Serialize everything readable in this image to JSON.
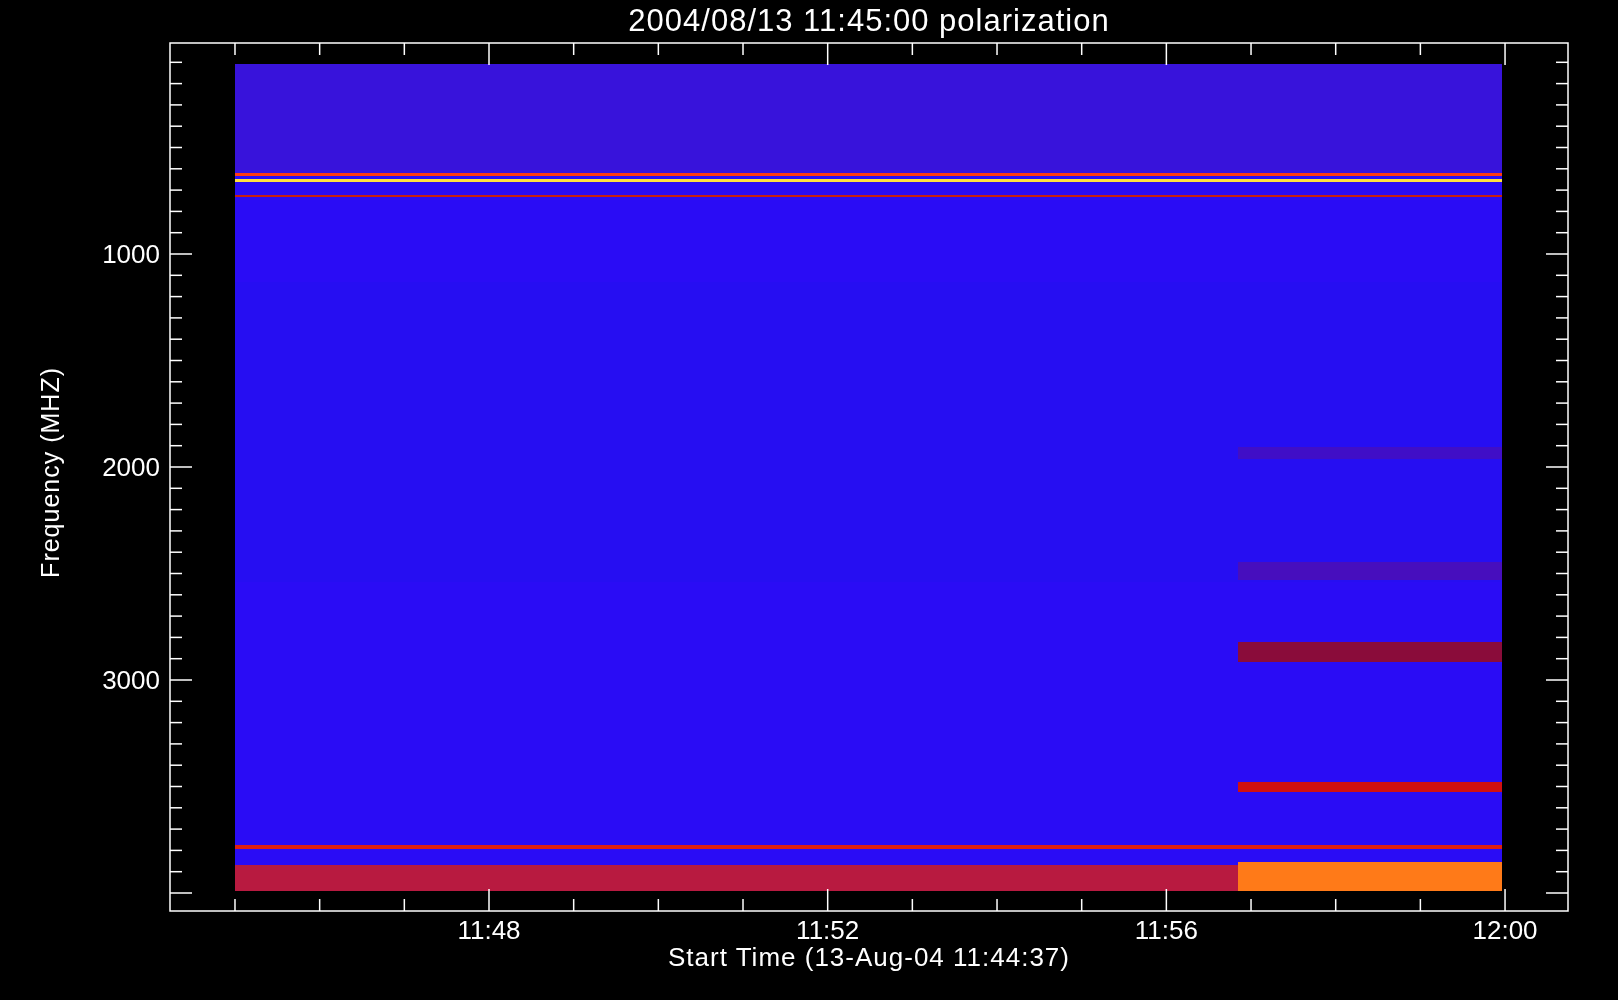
{
  "title": "2004/08/13 11:45:00 polarization",
  "y_axis": {
    "label": "Frequency (MHZ)",
    "ticks": [
      "1000",
      "2000",
      "3000"
    ]
  },
  "x_axis": {
    "label": "Start Time (13-Aug-04 11:44:37)",
    "ticks": [
      "11:48",
      "11:52",
      "11:56",
      "12:00"
    ]
  }
}
